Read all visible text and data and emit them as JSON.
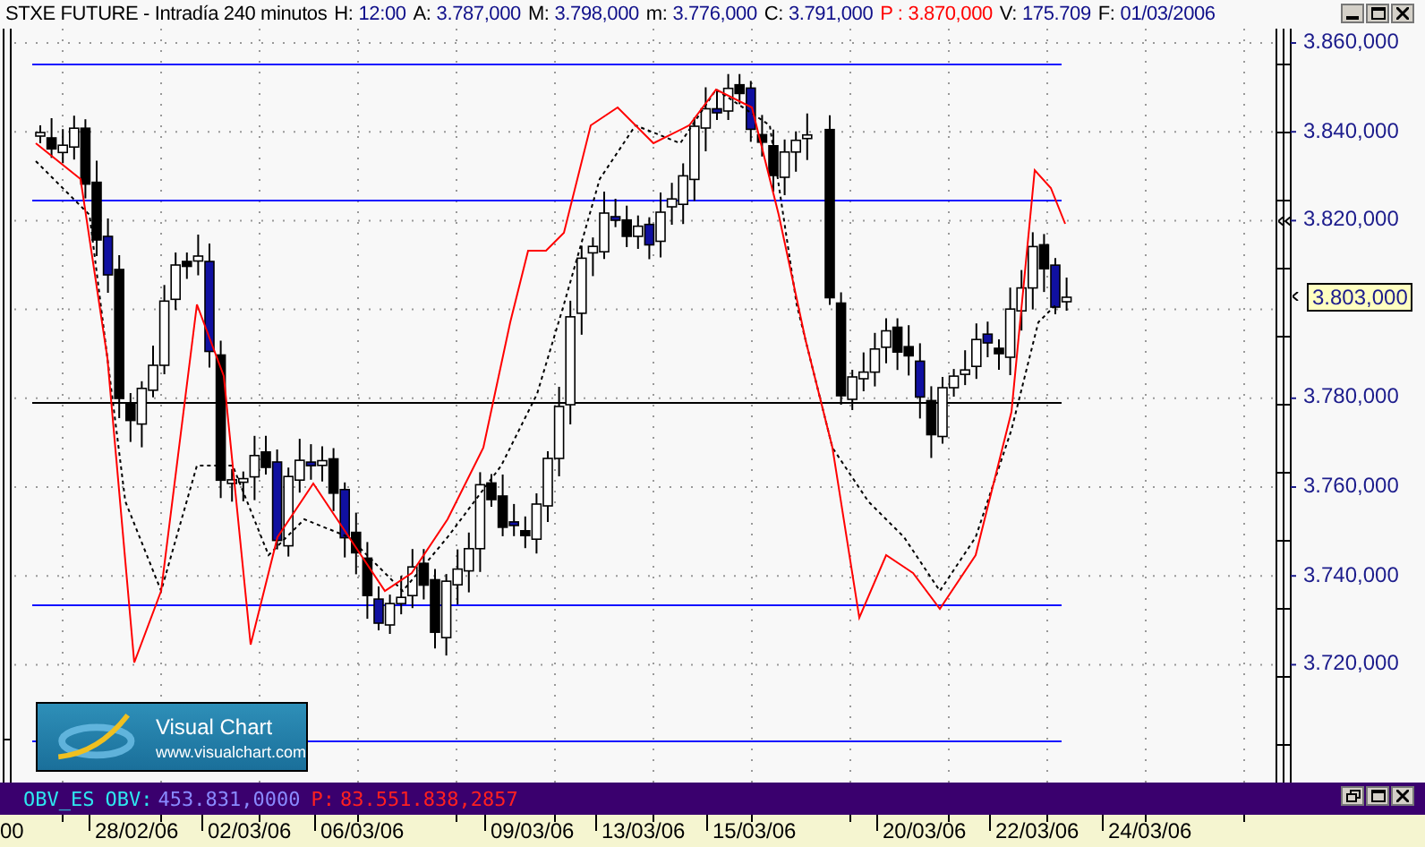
{
  "header": {
    "title": "STXE FUTURE - Intradía 240 minutos",
    "fields": [
      {
        "label": "H:",
        "value": "12:00",
        "kind": "plain"
      },
      {
        "label": "A:",
        "value": "3.787,000",
        "kind": "plain"
      },
      {
        "label": "M:",
        "value": "3.798,000",
        "kind": "plain"
      },
      {
        "label": "m:",
        "value": "3.776,000",
        "kind": "plain"
      },
      {
        "label": "C:",
        "value": "3.791,000",
        "kind": "plain"
      },
      {
        "label": "P :",
        "value": "3.870,000",
        "kind": "highlight"
      },
      {
        "label": "V:",
        "value": "175.709",
        "kind": "plain"
      },
      {
        "label": "F:",
        "value": "01/03/2006",
        "kind": "plain"
      }
    ]
  },
  "price_axis": {
    "labels": [
      "3.860,000",
      "3.840,000",
      "3.820,000",
      "3.780,000",
      "3.760,000",
      "3.740,000",
      "3.720,000"
    ],
    "current_price": "3.803,000"
  },
  "logo": {
    "name": "Visual Chart",
    "url": "www.visualchart.com"
  },
  "obv_panel": {
    "name": "OBV_ES",
    "fields": [
      {
        "label": "OBV:",
        "value": "453.831,0000",
        "kind": "plain"
      },
      {
        "label": "P:",
        "value": "83.551.838,2857",
        "kind": "highlight"
      }
    ]
  },
  "date_axis": {
    "labels": [
      "00",
      "28/02/06",
      "02/03/06",
      "06/03/06",
      "09/03/06",
      "13/03/06",
      "15/03/06",
      "20/03/06",
      "22/03/06",
      "24/03/06"
    ]
  }
}
